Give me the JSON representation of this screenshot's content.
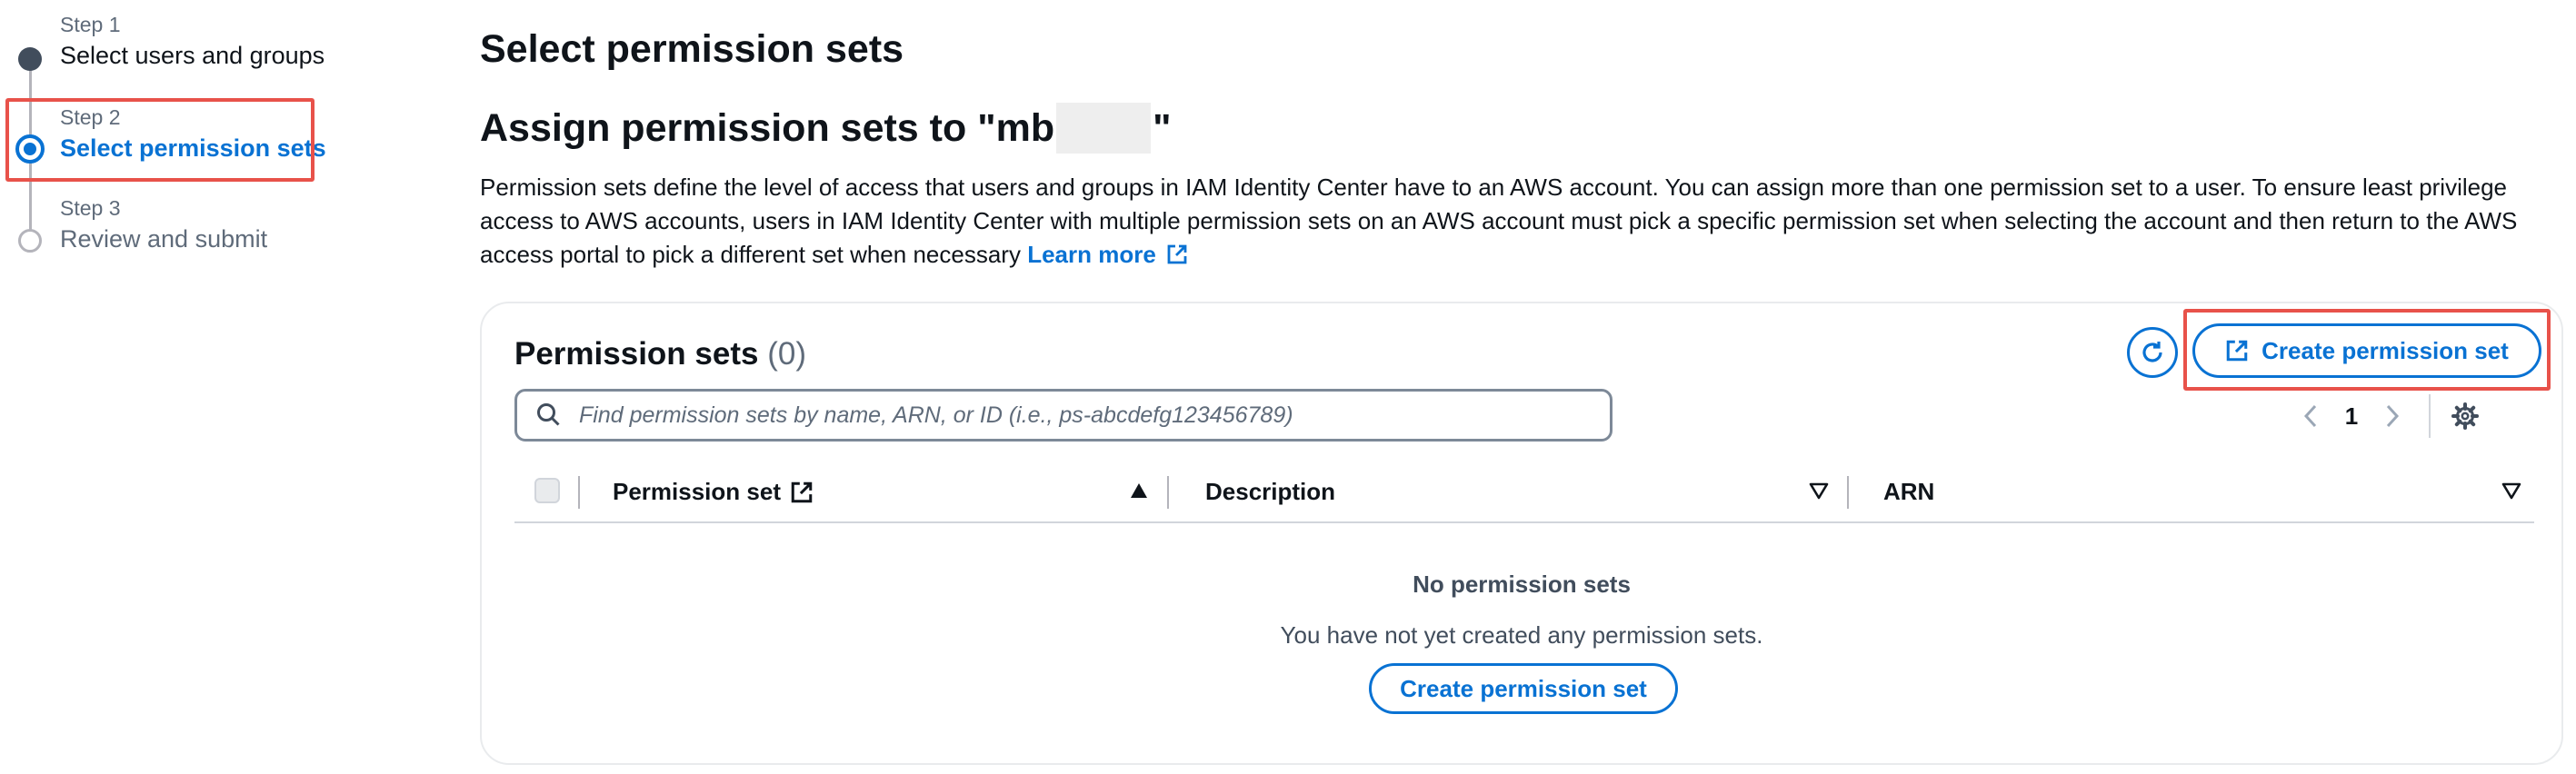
{
  "wizard": {
    "steps": [
      {
        "label": "Step 1",
        "title": "Select users and groups",
        "state": "complete"
      },
      {
        "label": "Step 2",
        "title": "Select permission sets",
        "state": "current"
      },
      {
        "label": "Step 3",
        "title": "Review and submit",
        "state": "pending"
      }
    ]
  },
  "page": {
    "title": "Select permission sets",
    "assign_prefix": "Assign permission sets to \"mb",
    "assign_suffix": "\"",
    "description": "Permission sets define the level of access that users and groups in IAM Identity Center have to an AWS account. You can assign more than one permission set to a user. To ensure least privilege access to AWS accounts, users in IAM Identity Center with multiple permission sets on an AWS account must pick a specific permission set when selecting the account and then return to the AWS access portal to pick a different set when necessary",
    "learn_more": "Learn more"
  },
  "permission_sets": {
    "title": "Permission sets",
    "count": "(0)",
    "create_button": "Create permission set",
    "search_placeholder": "Find permission sets by name, ARN, or ID (i.e., ps-abcdefg123456789)",
    "current_page": "1",
    "columns": [
      "Permission set",
      "Description",
      "ARN"
    ],
    "empty_title": "No permission sets",
    "empty_message": "You have not yet created any permission sets.",
    "empty_button": "Create permission set"
  },
  "colors": {
    "accent": "#0972d3",
    "highlight": "#e8524a",
    "text": "#0f141a",
    "muted": "#5f6b7a"
  }
}
